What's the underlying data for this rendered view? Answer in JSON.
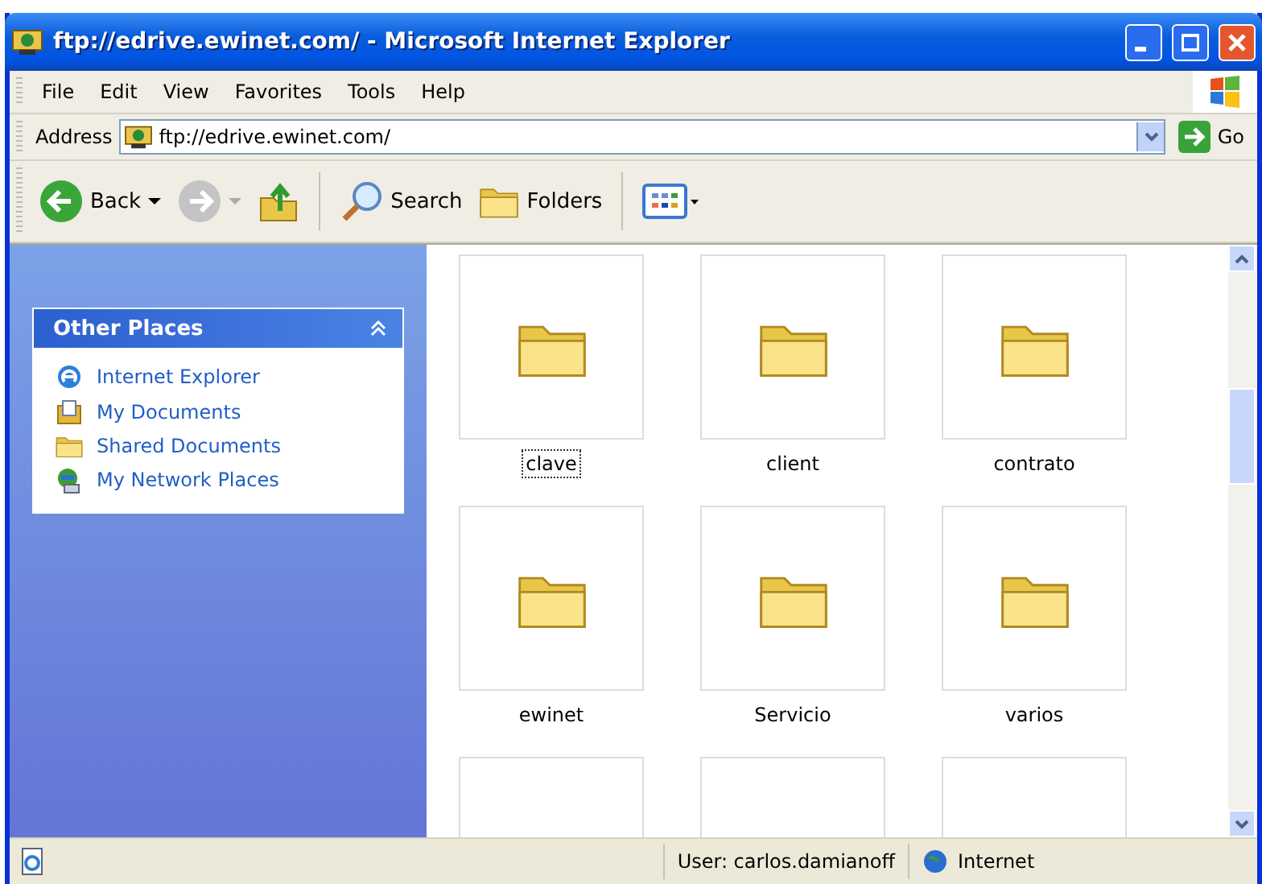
{
  "window": {
    "title": "ftp://edrive.ewinet.com/ - Microsoft Internet Explorer"
  },
  "menu": [
    "File",
    "Edit",
    "View",
    "Favorites",
    "Tools",
    "Help"
  ],
  "address_bar": {
    "label": "Address",
    "value": "ftp://edrive.ewinet.com/",
    "go": "Go"
  },
  "toolbar": [
    {
      "kind": "back",
      "label": "Back",
      "disabled": false
    },
    {
      "kind": "forward",
      "disabled": true
    },
    {
      "kind": "up"
    },
    {
      "kind": "search",
      "label": "Search"
    },
    {
      "kind": "folders",
      "label": "Folders"
    },
    {
      "kind": "views"
    }
  ],
  "sidebar": {
    "title": "Other Places",
    "expanded": true,
    "items": [
      {
        "kind": "ie",
        "label": "Internet Explorer"
      },
      {
        "kind": "documents",
        "label": "My Documents"
      },
      {
        "kind": "folder",
        "label": "Shared Documents"
      },
      {
        "kind": "network",
        "label": "My Network Places"
      }
    ]
  },
  "files": [
    {
      "name": "clave",
      "focused": true
    },
    {
      "name": "client",
      "focused": false
    },
    {
      "name": "contrato",
      "focused": false
    },
    {
      "name": "ewinet",
      "focused": false
    },
    {
      "name": "Servicio",
      "focused": false
    },
    {
      "name": "varios",
      "focused": false
    }
  ],
  "status_bar": {
    "user": "User: carlos.damianoff",
    "zone": "Internet"
  }
}
